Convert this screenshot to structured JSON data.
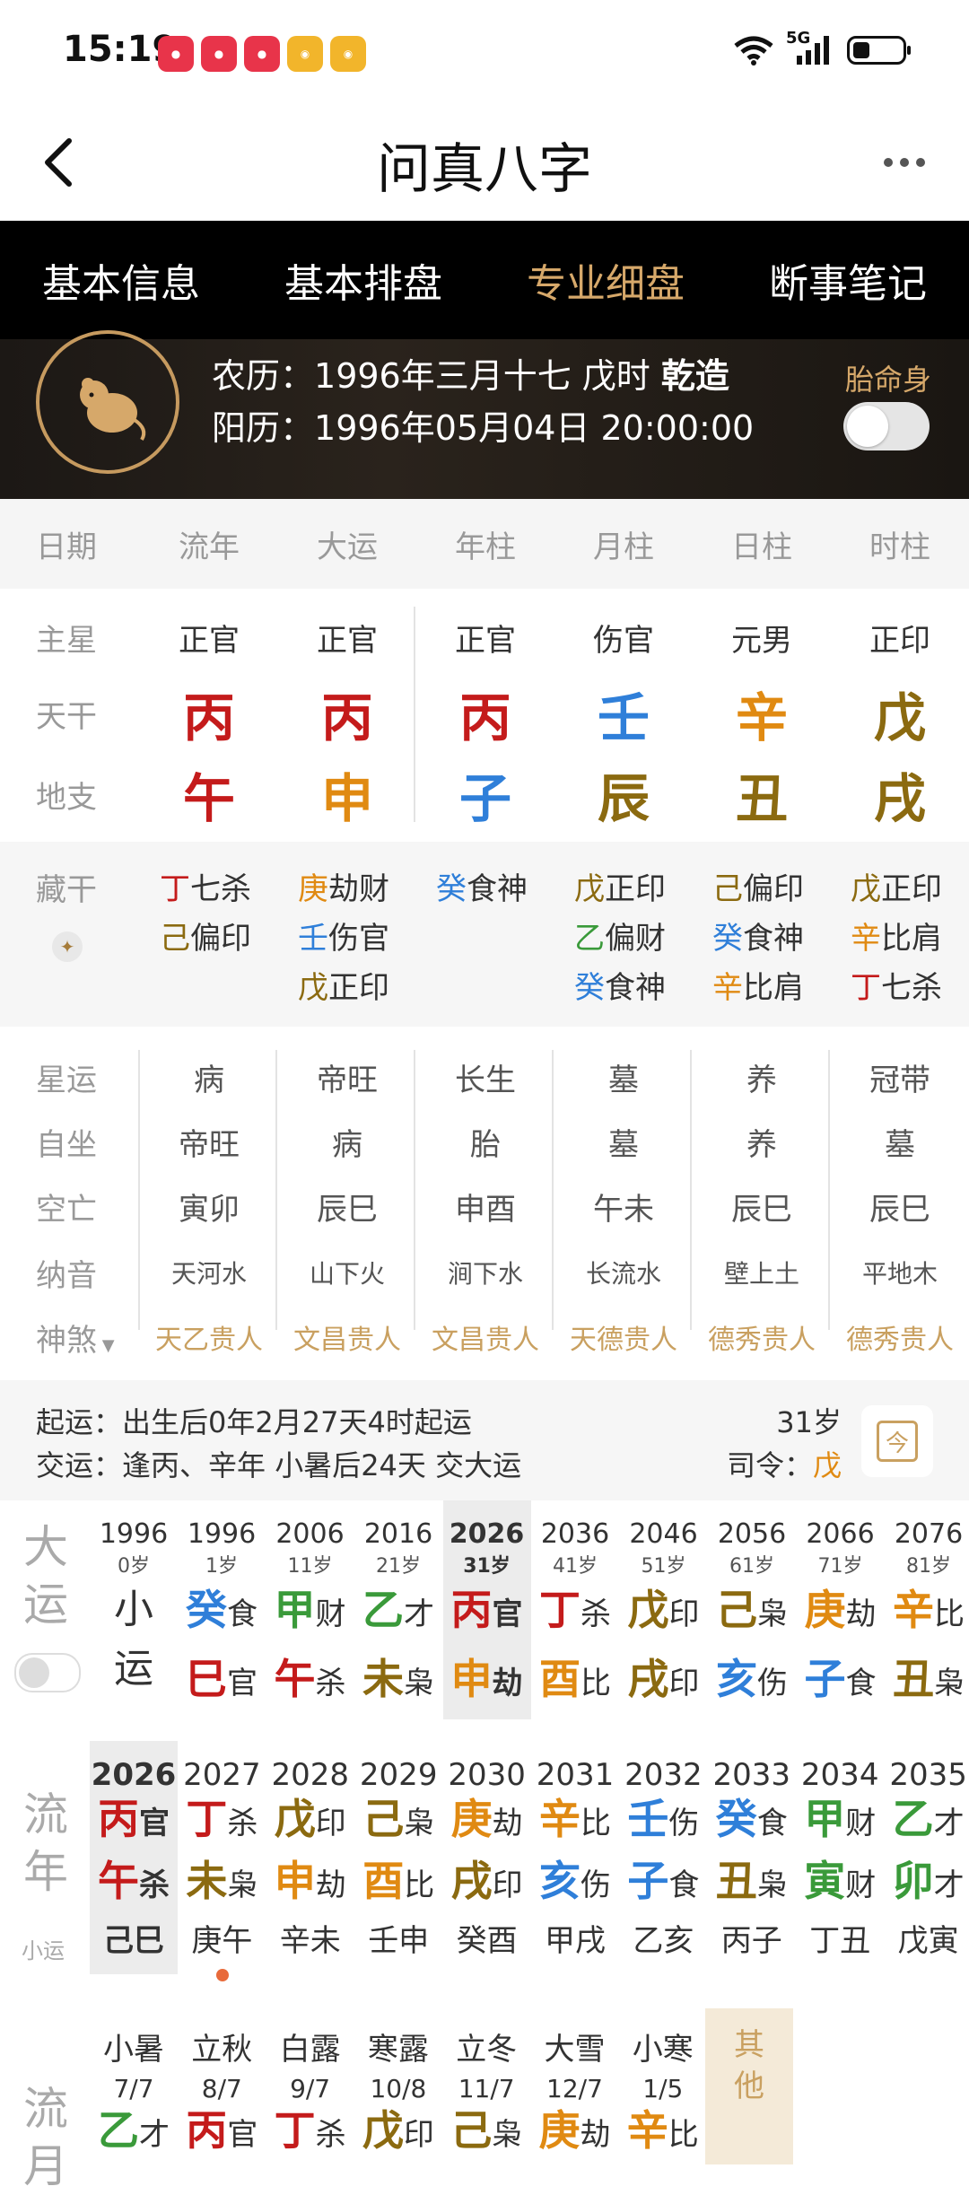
{
  "status_bar": {
    "time": "15:19",
    "network": "5G"
  },
  "nav": {
    "title": "问真八字"
  },
  "tabs": [
    {
      "label": "基本信息",
      "active": false
    },
    {
      "label": "基本排盘",
      "active": false
    },
    {
      "label": "专业细盘",
      "active": true
    },
    {
      "label": "断事笔记",
      "active": false
    }
  ],
  "profile": {
    "lunar_label": "农历：",
    "lunar_value": "1996年三月十七 戊时",
    "gender_tag": "乾造",
    "solar_label": "阳历：",
    "solar_value": "1996年05月04日 20:00:00",
    "taiming_label": "胎命身",
    "taiming_on": false
  },
  "columns": [
    "日期",
    "流年",
    "大运",
    "年柱",
    "月柱",
    "日柱",
    "时柱"
  ],
  "main_star": {
    "label": "主星",
    "values": [
      "正官",
      "正官",
      "正官",
      "伤官",
      "元男",
      "正印"
    ]
  },
  "tiangan": {
    "label": "天干",
    "values": [
      "丙",
      "丙",
      "丙",
      "壬",
      "辛",
      "戊"
    ]
  },
  "dizhi": {
    "label": "地支",
    "values": [
      "午",
      "申",
      "子",
      "辰",
      "丑",
      "戌"
    ]
  },
  "canggan": {
    "label": "藏干",
    "cols": [
      [
        {
          "g": "丁",
          "t": "七杀"
        },
        {
          "g": "己",
          "t": "偏印"
        }
      ],
      [
        {
          "g": "庚",
          "t": "劫财"
        },
        {
          "g": "壬",
          "t": "伤官"
        },
        {
          "g": "戊",
          "t": "正印"
        }
      ],
      [
        {
          "g": "癸",
          "t": "食神"
        }
      ],
      [
        {
          "g": "戊",
          "t": "正印"
        },
        {
          "g": "乙",
          "t": "偏财"
        },
        {
          "g": "癸",
          "t": "食神"
        }
      ],
      [
        {
          "g": "己",
          "t": "偏印"
        },
        {
          "g": "癸",
          "t": "食神"
        },
        {
          "g": "辛",
          "t": "比肩"
        }
      ],
      [
        {
          "g": "戊",
          "t": "正印"
        },
        {
          "g": "辛",
          "t": "比肩"
        },
        {
          "g": "丁",
          "t": "七杀"
        }
      ]
    ]
  },
  "xingyun": {
    "label": "星运",
    "values": [
      "病",
      "帝旺",
      "长生",
      "墓",
      "养",
      "冠带"
    ]
  },
  "zizuo": {
    "label": "自坐",
    "values": [
      "帝旺",
      "病",
      "胎",
      "墓",
      "养",
      "墓"
    ]
  },
  "kongwang": {
    "label": "空亡",
    "values": [
      "寅卯",
      "辰巳",
      "申酉",
      "午未",
      "辰巳",
      "辰巳"
    ]
  },
  "nayin": {
    "label": "纳音",
    "values": [
      "天河水",
      "山下火",
      "涧下水",
      "长流水",
      "壁上土",
      "平地木"
    ]
  },
  "shensha": {
    "label": "神煞",
    "values": [
      "天乙贵人",
      "文昌贵人",
      "文昌贵人",
      "天德贵人",
      "德秀贵人",
      "德秀贵人"
    ]
  },
  "qiyun": {
    "line1_label": "起运：",
    "line1_value": "出生后0年2月27天4时起运",
    "line2_label": "交运：",
    "line2_value": "逢丙、辛年 小暑后24天 交大运",
    "age": "31岁",
    "siling_label": "司令：",
    "siling_value": "戊",
    "cal_icon_text": "今"
  },
  "dayun": {
    "label": "大运",
    "xiaoyun": [
      "小",
      "运"
    ],
    "items": [
      {
        "year": "1996",
        "age": "1岁",
        "g": "癸",
        "gt": "食",
        "z": "巳",
        "zt": "官"
      },
      {
        "year": "2006",
        "age": "11岁",
        "g": "甲",
        "gt": "财",
        "z": "午",
        "zt": "杀"
      },
      {
        "year": "2016",
        "age": "21岁",
        "g": "乙",
        "gt": "才",
        "z": "未",
        "zt": "枭"
      },
      {
        "year": "2026",
        "age": "31岁",
        "g": "丙",
        "gt": "官",
        "z": "申",
        "zt": "劫"
      },
      {
        "year": "2036",
        "age": "41岁",
        "g": "丁",
        "gt": "杀",
        "z": "酉",
        "zt": "比"
      },
      {
        "year": "2046",
        "age": "51岁",
        "g": "戊",
        "gt": "印",
        "z": "戌",
        "zt": "印"
      },
      {
        "year": "2056",
        "age": "61岁",
        "g": "己",
        "gt": "枭",
        "z": "亥",
        "zt": "伤"
      },
      {
        "year": "2066",
        "age": "71岁",
        "g": "庚",
        "gt": "劫",
        "z": "子",
        "zt": "食"
      },
      {
        "year": "2076",
        "age": "81岁",
        "g": "辛",
        "gt": "比",
        "z": "丑",
        "zt": "枭"
      }
    ],
    "first": {
      "year": "1996",
      "age": "0岁"
    }
  },
  "liunian": {
    "label": [
      "流",
      "年"
    ],
    "sub_label": "小运",
    "items": [
      {
        "year": "2026",
        "g": "丙",
        "gt": "官",
        "z": "午",
        "zt": "杀",
        "xy": "己巳"
      },
      {
        "year": "2027",
        "g": "丁",
        "gt": "杀",
        "z": "未",
        "zt": "枭",
        "xy": "庚午"
      },
      {
        "year": "2028",
        "g": "戊",
        "gt": "印",
        "z": "申",
        "zt": "劫",
        "xy": "辛未"
      },
      {
        "year": "2029",
        "g": "己",
        "gt": "枭",
        "z": "酉",
        "zt": "比",
        "xy": "壬申"
      },
      {
        "year": "2030",
        "g": "庚",
        "gt": "劫",
        "z": "戌",
        "zt": "印",
        "xy": "癸酉"
      },
      {
        "year": "2031",
        "g": "辛",
        "gt": "比",
        "z": "亥",
        "zt": "伤",
        "xy": "甲戌"
      },
      {
        "year": "2032",
        "g": "壬",
        "gt": "伤",
        "z": "子",
        "zt": "食",
        "xy": "乙亥"
      },
      {
        "year": "2033",
        "g": "癸",
        "gt": "食",
        "z": "丑",
        "zt": "枭",
        "xy": "丙子"
      },
      {
        "year": "2034",
        "g": "甲",
        "gt": "财",
        "z": "寅",
        "zt": "财",
        "xy": "丁丑"
      },
      {
        "year": "2035",
        "g": "乙",
        "gt": "才",
        "z": "卯",
        "zt": "才",
        "xy": "戊寅"
      }
    ]
  },
  "liuyue": {
    "label": [
      "流",
      "月"
    ],
    "items": [
      {
        "term": "小暑",
        "date": "7/7",
        "g": "乙",
        "gt": "才"
      },
      {
        "term": "立秋",
        "date": "8/7",
        "g": "丙",
        "gt": "官"
      },
      {
        "term": "白露",
        "date": "9/7",
        "g": "丁",
        "gt": "杀"
      },
      {
        "term": "寒露",
        "date": "10/8",
        "g": "戊",
        "gt": "印"
      },
      {
        "term": "立冬",
        "date": "11/7",
        "g": "己",
        "gt": "枭"
      },
      {
        "term": "大雪",
        "date": "12/7",
        "g": "庚",
        "gt": "劫"
      },
      {
        "term": "小寒",
        "date": "1/5",
        "g": "辛",
        "gt": "比"
      }
    ],
    "other": [
      "其",
      "他"
    ]
  }
}
